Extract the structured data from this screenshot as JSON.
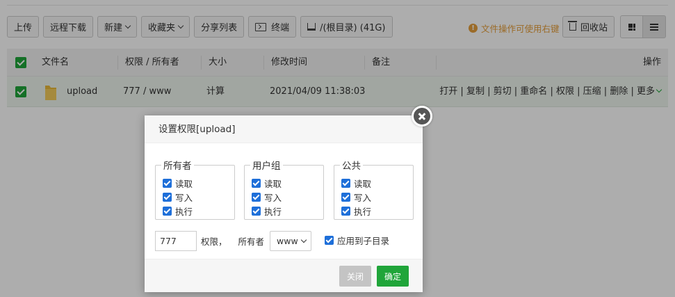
{
  "toolbar": {
    "upload": "上传",
    "remote_download": "远程下载",
    "new": "新建",
    "favorites": "收藏夹",
    "share_list": "分享列表",
    "terminal": "终端",
    "disk": "/(根目录) (41G)"
  },
  "notice": "文件操作可使用右键",
  "recycle_bin": "回收站",
  "table": {
    "headers": {
      "name": "文件名",
      "perm_owner": "权限 / 所有者",
      "size": "大小",
      "mtime": "修改时间",
      "remark": "备注",
      "actions": "操作"
    },
    "row": {
      "name": "upload",
      "perm_owner": "777 / www",
      "size": "计算",
      "mtime": "2021/04/09 11:38:03",
      "actions": [
        "打开",
        "复制",
        "剪切",
        "重命名",
        "权限",
        "压缩",
        "删除",
        "更多"
      ]
    }
  },
  "dialog": {
    "title": "设置权限[upload]",
    "groups": [
      {
        "legend": "所有者",
        "items": [
          "读取",
          "写入",
          "执行"
        ]
      },
      {
        "legend": "用户组",
        "items": [
          "读取",
          "写入",
          "执行"
        ]
      },
      {
        "legend": "公共",
        "items": [
          "读取",
          "写入",
          "执行"
        ]
      }
    ],
    "perm_value": "777",
    "perm_label": "权限，",
    "owner_label": "所有者",
    "owner_value": "www",
    "apply_subdir": "应用到子目录",
    "close_btn": "关闭",
    "ok_btn": "确定"
  },
  "colors": {
    "accent": "#20a53a",
    "notice": "#e59e3b",
    "checkbox": "#1e6fd9"
  }
}
